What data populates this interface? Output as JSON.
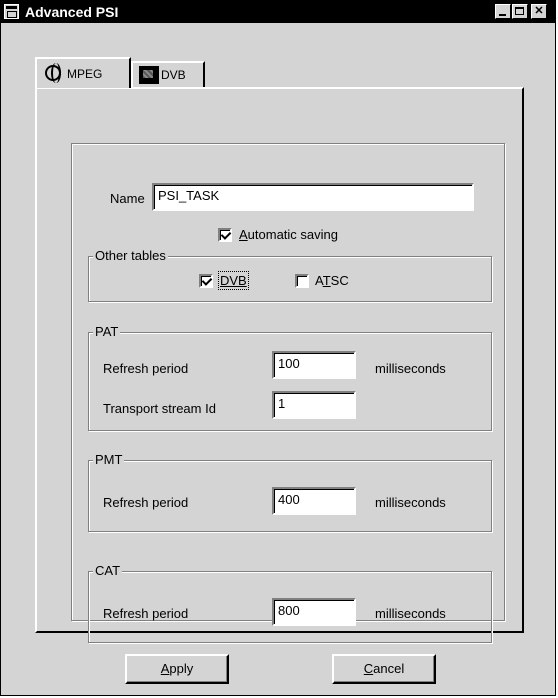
{
  "window": {
    "title": "Advanced PSI"
  },
  "tabs": [
    {
      "label": "MPEG",
      "icon": "globe-icon",
      "active": true
    },
    {
      "label": "DVB",
      "icon": "dvb-icon",
      "active": false
    }
  ],
  "form": {
    "name_label": "Name",
    "name_value": "PSI_TASK",
    "auto_save": {
      "label_ul": "A",
      "label_rest": "utomatic saving",
      "checked": true
    }
  },
  "other_tables": {
    "legend": "Other tables",
    "dvb": {
      "label": "DVB",
      "checked": true
    },
    "atsc": {
      "label_pre": "A",
      "label_ul": "T",
      "label_post": "SC",
      "checked": false
    }
  },
  "pat": {
    "legend": "PAT",
    "refresh_label": "Refresh period",
    "refresh_value": "100",
    "refresh_unit": "milliseconds",
    "tsid_label": "Transport stream Id",
    "tsid_value": "1"
  },
  "pmt": {
    "legend": "PMT",
    "refresh_label": "Refresh period",
    "refresh_value": "400",
    "refresh_unit": "milliseconds"
  },
  "cat": {
    "legend": "CAT",
    "refresh_label": "Refresh period",
    "refresh_value": "800",
    "refresh_unit": "milliseconds"
  },
  "buttons": {
    "apply_ul": "A",
    "apply_rest": "pply",
    "cancel_ul": "C",
    "cancel_rest": "ancel"
  }
}
